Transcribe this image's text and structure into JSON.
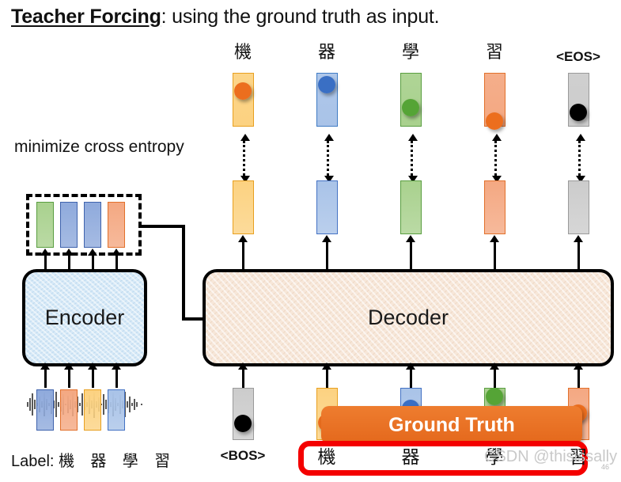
{
  "title": {
    "emphasis": "Teacher Forcing",
    "rest": ": using the ground truth as input."
  },
  "annotations": {
    "minimize_cross_entropy": "minimize cross entropy",
    "bos_label": "<BOS>",
    "caption_prefix": "Label: ",
    "caption_chars": "機 器 學 習",
    "watermark": "CSDN @thisissally",
    "page_number": "46"
  },
  "blocks": {
    "encoder_label": "Encoder",
    "decoder_label": "Decoder",
    "ground_truth_label": "Ground Truth"
  },
  "output_tokens": [
    {
      "label": "機",
      "bar_color": "#fcd281",
      "border_color": "#e8a020",
      "dot_color": "#ec6e1e",
      "dot_top_pct": 18
    },
    {
      "label": "器",
      "bar_color": "#a9c3e8",
      "border_color": "#3f7bc4",
      "dot_color": "#3a6fc4",
      "dot_top_pct": 6
    },
    {
      "label": "學",
      "bar_color": "#a9d18e",
      "border_color": "#5a9e41",
      "dot_color": "#55a436",
      "dot_top_pct": 48
    },
    {
      "label": "習",
      "bar_color": "#f4a882",
      "border_color": "#e2712c",
      "dot_color": "#ec6e1e",
      "dot_top_pct": 76
    },
    {
      "label": "<EOS>",
      "bar_color": "#cccccc",
      "border_color": "#9a9a9a",
      "dot_color": "#000000",
      "dot_top_pct": 58
    }
  ],
  "hidden_bars": [
    {
      "bar_color": "#fcd281",
      "border_color": "#e8a020"
    },
    {
      "bar_color": "#a9c3e8",
      "border_color": "#4472c4"
    },
    {
      "bar_color": "#a9d18e",
      "border_color": "#5a9e41"
    },
    {
      "bar_color": "#f4a882",
      "border_color": "#e2712c"
    },
    {
      "bar_color": "#cccccc",
      "border_color": "#9a9a9a"
    }
  ],
  "encoder_outputs": [
    {
      "bar_color": "#a9d18e",
      "border_color": "#5a9e41"
    },
    {
      "bar_color": "#8faadc",
      "border_color": "#3f63ad"
    },
    {
      "bar_color": "#8faadc",
      "border_color": "#3f63ad"
    },
    {
      "bar_color": "#f4a882",
      "border_color": "#e2712c"
    }
  ],
  "speech_segments": [
    {
      "bar_color": "#8faadc",
      "border_color": "#3f63ad"
    },
    {
      "bar_color": "#f4a882",
      "border_color": "#e2712c"
    },
    {
      "bar_color": "#fcd281",
      "border_color": "#e8a020"
    },
    {
      "bar_color": "#a9c3e8",
      "border_color": "#4472c4"
    }
  ],
  "decoder_inputs": [
    {
      "label": "<BOS>",
      "bar_color": "#cccccc",
      "border_color": "#9a9a9a",
      "dot_color": "#000000",
      "dot_top_pct": 52
    },
    {
      "label": "機",
      "bar_color": "#fcd281",
      "border_color": "#e8a020",
      "dot_color": "#ec6e1e",
      "dot_top_pct": 50
    },
    {
      "label": "器",
      "bar_color": "#a9c3e8",
      "border_color": "#4472c4",
      "dot_color": "#3a6fc4",
      "dot_top_pct": 22
    },
    {
      "label": "學",
      "bar_color": "#a9d18e",
      "border_color": "#5a9e41",
      "dot_color": "#55a436",
      "dot_top_pct": 0
    },
    {
      "label": "習",
      "bar_color": "#f4a882",
      "border_color": "#e2712c",
      "dot_color": "#ec6e1e",
      "dot_top_pct": 32
    }
  ],
  "ground_truth_chars": [
    "機",
    "器",
    "學",
    "習"
  ],
  "colors": {
    "accent_orange": "#e4681c",
    "highlight_red": "#f40000",
    "encoder_fill": "#d6e9f7",
    "decoder_fill": "#f7e7d9"
  }
}
